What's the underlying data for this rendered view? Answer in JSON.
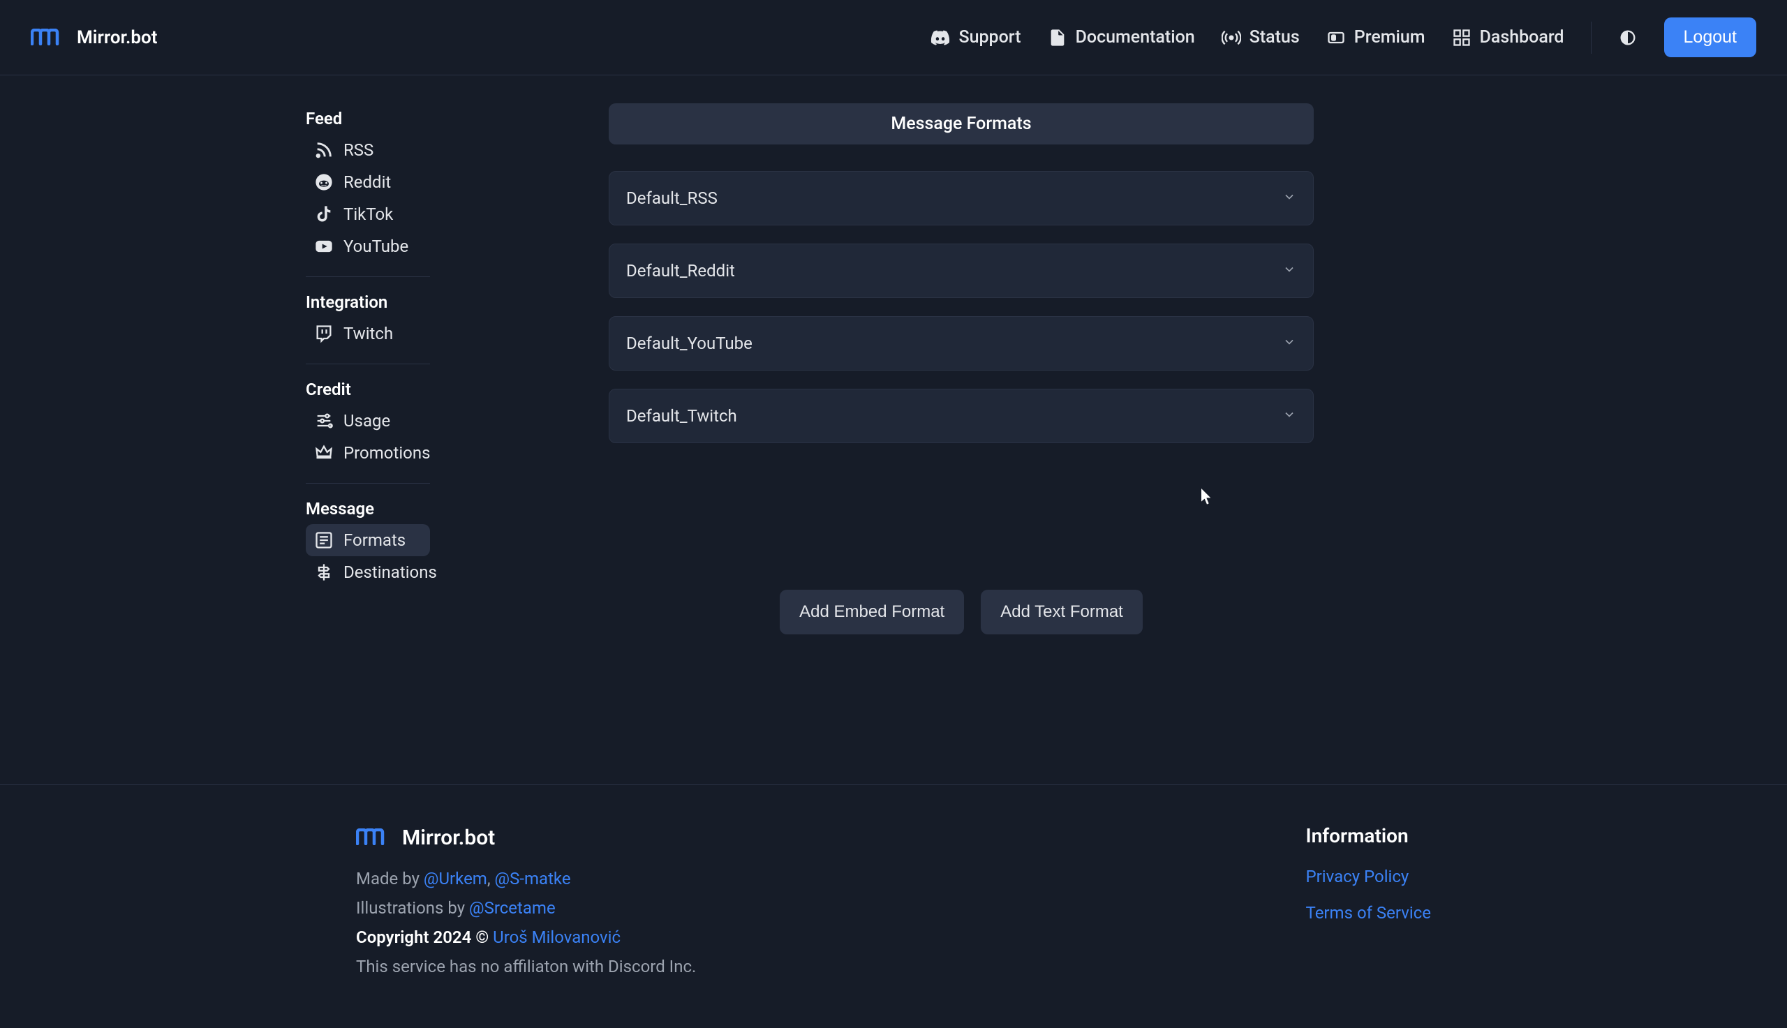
{
  "brand": {
    "name": "Mirror.bot"
  },
  "header": {
    "nav": {
      "support": "Support",
      "documentation": "Documentation",
      "status": "Status",
      "premium": "Premium",
      "dashboard": "Dashboard"
    },
    "logout": "Logout"
  },
  "sidebar": {
    "feed": {
      "title": "Feed",
      "rss": "RSS",
      "reddit": "Reddit",
      "tiktok": "TikTok",
      "youtube": "YouTube"
    },
    "integration": {
      "title": "Integration",
      "twitch": "Twitch"
    },
    "credit": {
      "title": "Credit",
      "usage": "Usage",
      "promotions": "Promotions"
    },
    "message": {
      "title": "Message",
      "formats": "Formats",
      "destinations": "Destinations"
    }
  },
  "main": {
    "title": "Message Formats",
    "formats": {
      "rss": "Default_RSS",
      "reddit": "Default_Reddit",
      "youtube": "Default_YouTube",
      "twitch": "Default_Twitch"
    },
    "add_embed": "Add Embed Format",
    "add_text": "Add Text Format"
  },
  "footer": {
    "brand": "Mirror.bot",
    "made_by_prefix": "Made by ",
    "made_by_1": "@Urkem",
    "made_by_sep": ", ",
    "made_by_2": "@S-matke",
    "illus_prefix": "Illustrations by ",
    "illus_by": "@Srcetame",
    "copyright_prefix": "Copyright 2024 © ",
    "copyright_name": "Uroš Milovanović",
    "disclaimer": "This service has no affiliaton with Discord Inc.",
    "info_title": "Information",
    "privacy": "Privacy Policy",
    "terms": "Terms of Service"
  }
}
